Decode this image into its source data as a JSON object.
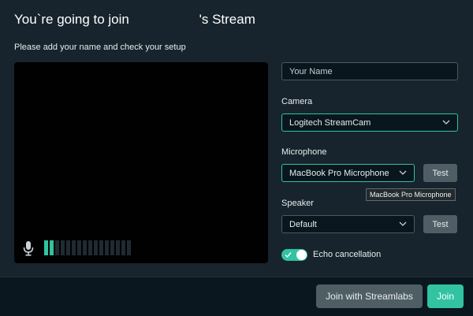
{
  "header": {
    "title_prefix": "You`re going to join",
    "title_suffix": "'s Stream",
    "subtitle": "Please add your name and check your setup"
  },
  "preview": {
    "mic_icon": "microphone-icon",
    "meter_level": 0.14,
    "meter_bars": 16,
    "meter_on": 2
  },
  "form": {
    "name_placeholder": "Your Name",
    "name_value": "",
    "camera_label": "Camera",
    "camera_selected": "Logitech StreamCam",
    "microphone_label": "Microphone",
    "microphone_selected": "MacBook Pro Microphone",
    "microphone_tooltip": "MacBook Pro Microphone",
    "speaker_label": "Speaker",
    "speaker_selected": "Default",
    "test_label": "Test",
    "echo_label": "Echo cancellation",
    "echo_enabled": true
  },
  "footer": {
    "streamlabs_label": "Join with Streamlabs",
    "join_label": "Join"
  },
  "colors": {
    "accent": "#31c3a2",
    "background": "#17242d",
    "button_secondary": "#4f5e65"
  }
}
